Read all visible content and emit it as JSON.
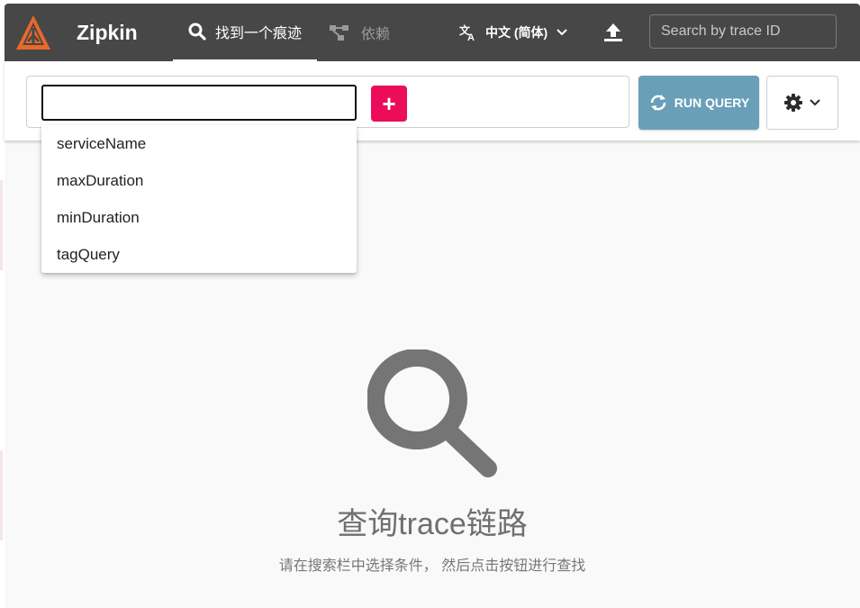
{
  "header": {
    "brand": "Zipkin",
    "tabs": [
      {
        "label": "找到一个痕迹",
        "active": true,
        "icon": "search-icon"
      },
      {
        "label": "依赖",
        "active": false,
        "icon": "dependencies-icon"
      }
    ],
    "language": {
      "label": "中文 (简体)",
      "icon": "translate-icon"
    },
    "upload_icon": "upload-icon",
    "trace_search": {
      "placeholder": "Search by trace ID",
      "value": ""
    }
  },
  "query": {
    "criteria_value": "",
    "add_label": "+",
    "run_label": "RUN QUERY",
    "settings_icon": "gear-icon"
  },
  "dropdown": {
    "items": [
      "serviceName",
      "maxDuration",
      "minDuration",
      "tagQuery"
    ]
  },
  "empty_state": {
    "icon": "search-icon",
    "title": "查询trace链路",
    "subtitle": "请在搜索栏中选择条件， 然后点击按钮进行查找"
  },
  "colors": {
    "header_bg": "#474747",
    "logo": "#e8692b",
    "add_button": "#ec0d5a",
    "run_button": "#6a9fb8",
    "main_bg": "#f9f9f9"
  }
}
